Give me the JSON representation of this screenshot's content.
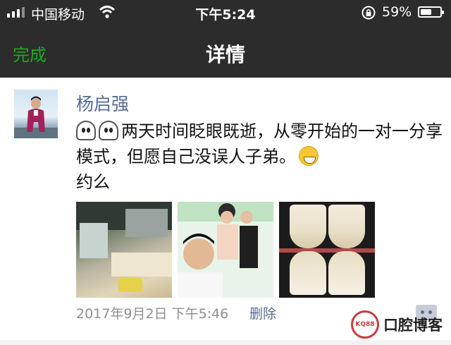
{
  "status_bar": {
    "carrier": "中国移动",
    "time": "下午5:24",
    "battery_percent": "59%",
    "battery_level": 0.59,
    "icons": [
      "signal-icon",
      "wifi-icon",
      "orientation-lock-icon",
      "battery-icon"
    ]
  },
  "nav": {
    "done_label": "完成",
    "title": "详情"
  },
  "post": {
    "author": "杨启强",
    "text_main": "两天时间眨眼既逝，从零开始的一对一分享模式，但愿自己没误人子弟。",
    "text_tail": "约么",
    "emoji": [
      "ghost-emoji",
      "ghost-emoji",
      "smile-emoji"
    ],
    "images": [
      "classroom-photo",
      "group-selfie-photo",
      "teeth-closeup-photo"
    ],
    "timestamp": "2017年9月2日 下午5:46",
    "delete_label": "删除"
  },
  "watermark": {
    "logo_text": "KQ88",
    "site_name": "口腔博客"
  },
  "colors": {
    "header_bg": "#2c2c2c",
    "done_green": "#1aad19",
    "link_blue": "#576b95",
    "meta_gray": "#8f8f8f"
  }
}
